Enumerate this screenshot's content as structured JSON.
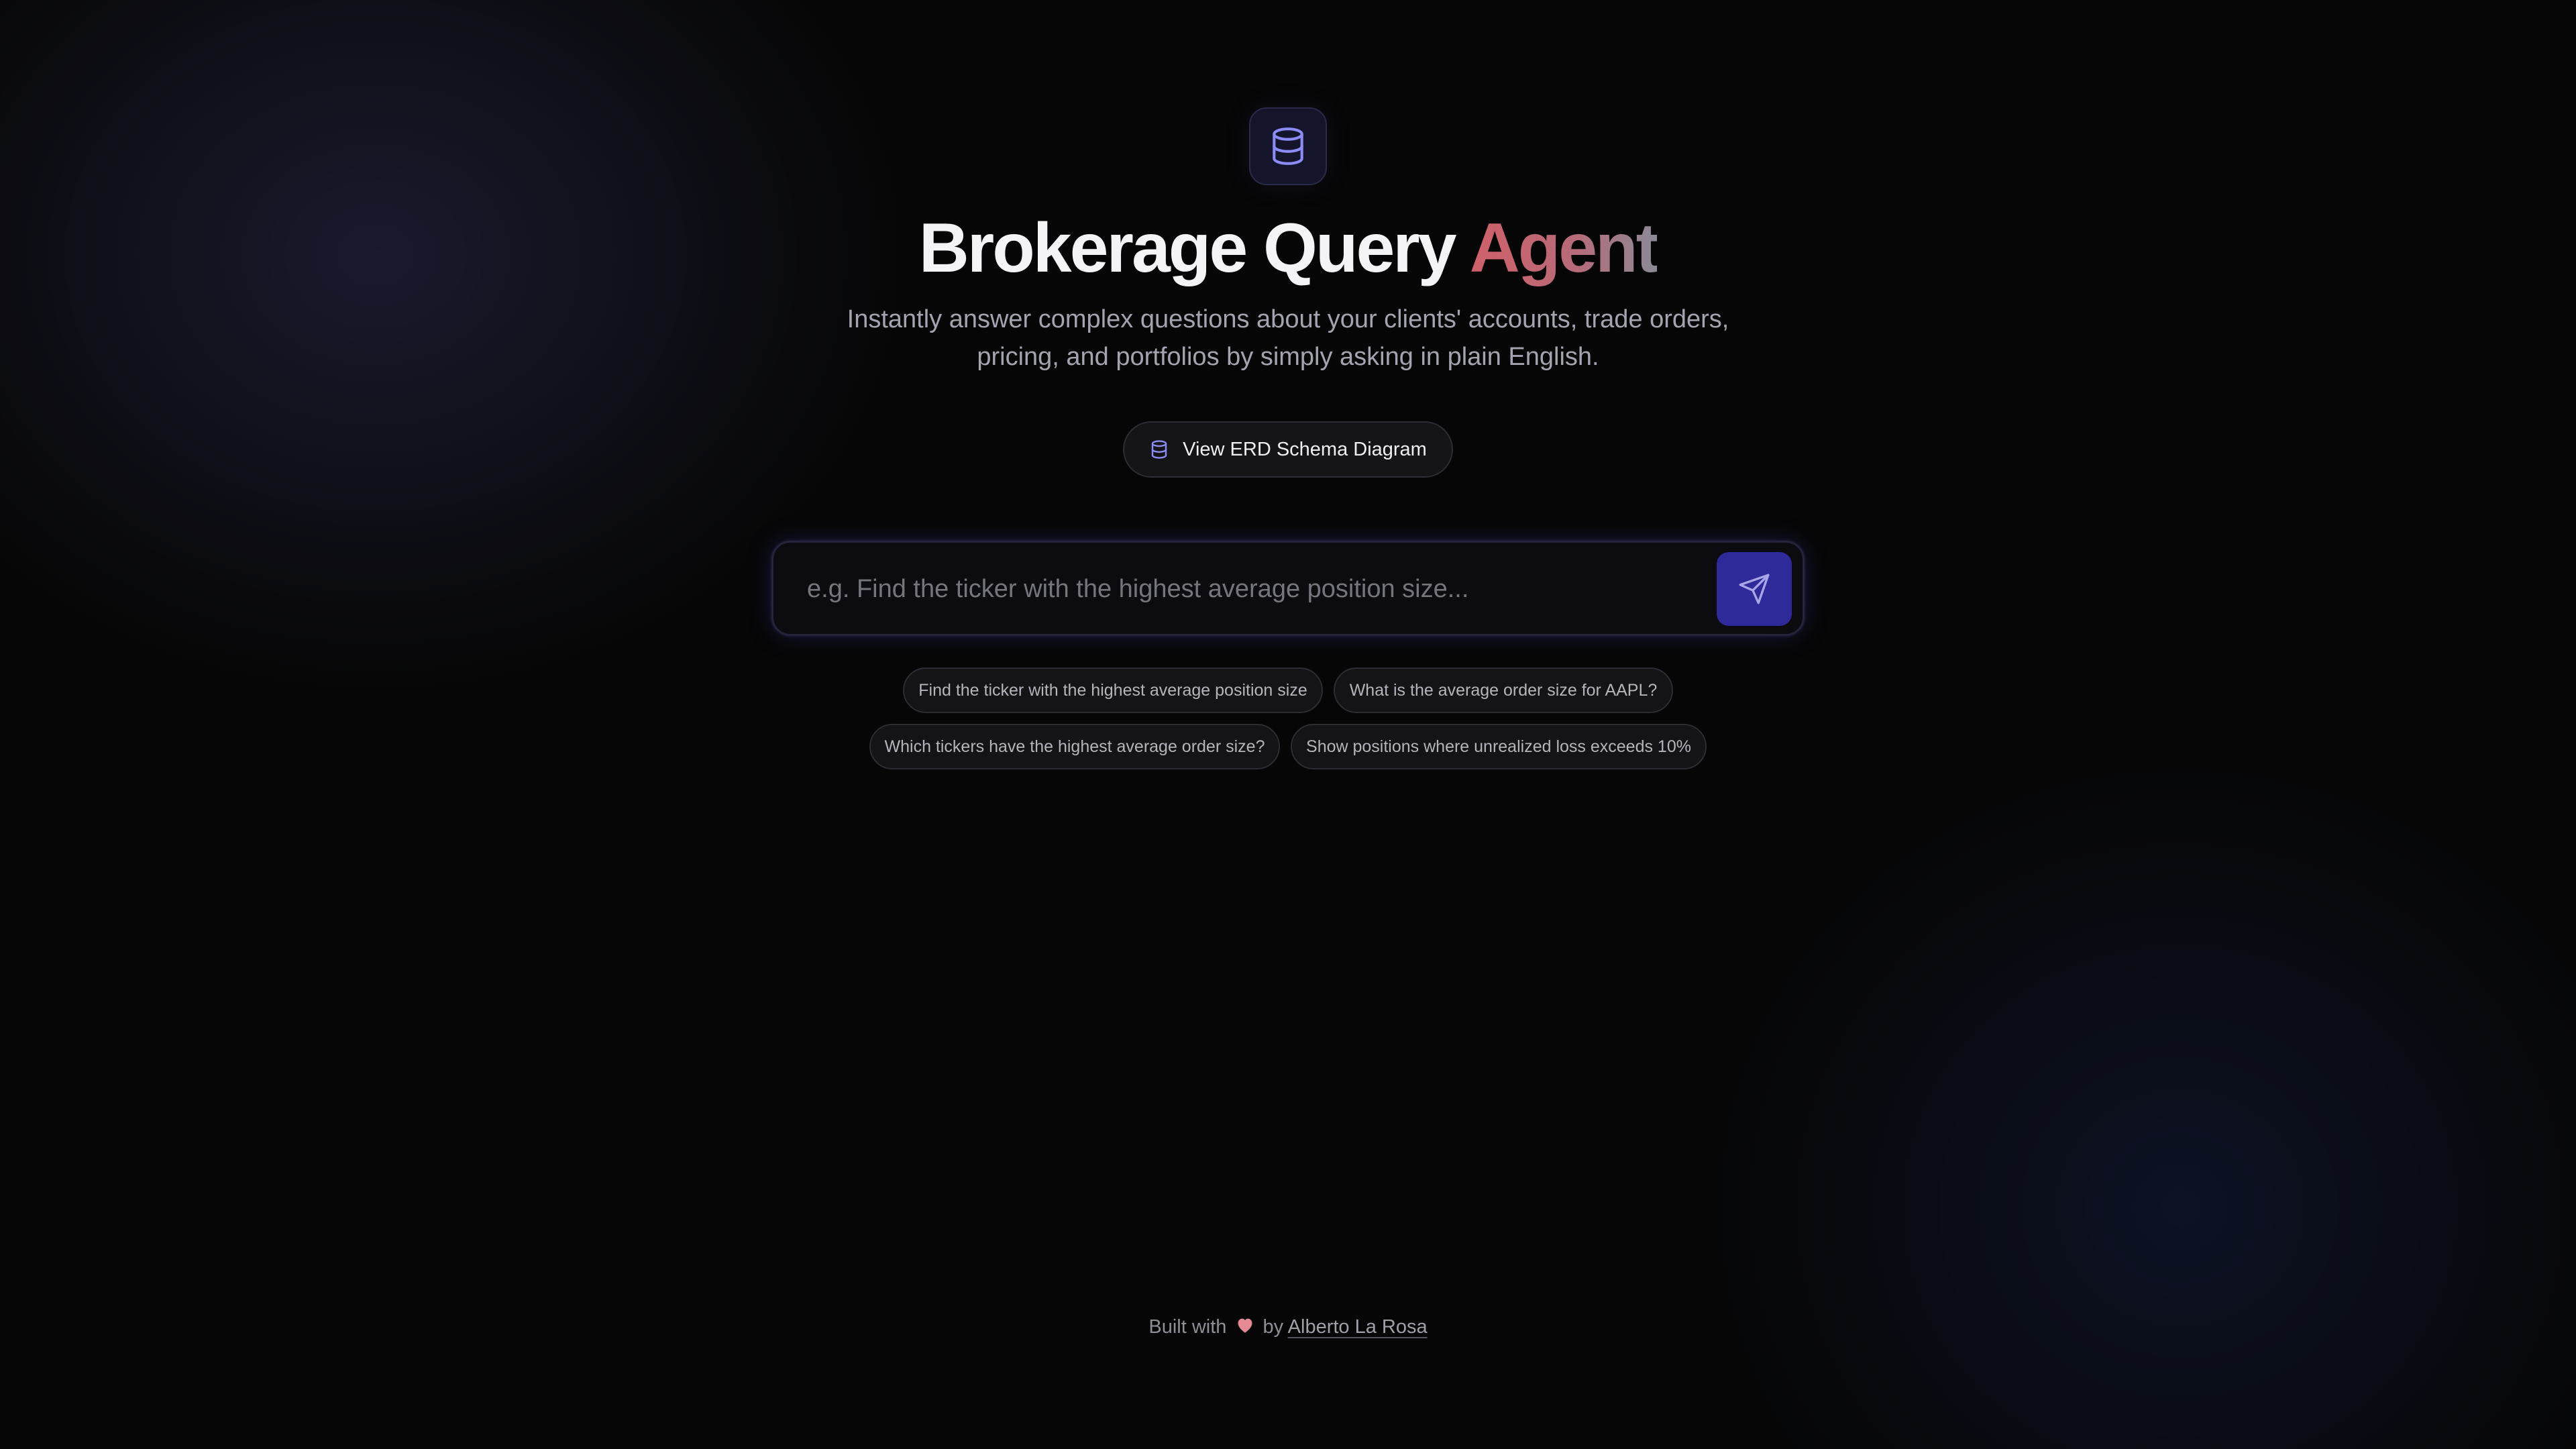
{
  "header": {
    "logo_icon": "database-icon",
    "title_main": "Brokerage Query ",
    "title_accent": "Agent",
    "subtitle": "Instantly answer complex questions about your clients' accounts, trade orders, pricing, and portfolios by simply asking in plain English."
  },
  "erd_button": {
    "icon": "database-icon",
    "label": "View ERD Schema Diagram"
  },
  "search": {
    "value": "",
    "placeholder": "e.g. Find the ticker with the highest average position size...",
    "send_icon": "send-icon"
  },
  "suggestions": [
    "Find the ticker with the highest average position size",
    "What is the average order size for AAPL?",
    "Which tickers have the highest average order size?",
    "Show positions where unrealized loss exceeds 10%"
  ],
  "footer": {
    "prefix": "Built with",
    "heart_icon": "heart-icon",
    "by": "by",
    "author": "Alberto La Rosa"
  },
  "colors": {
    "accent_start": "#d0606a",
    "accent_end": "#8a8a96",
    "send_button": "#2f2a9a",
    "icon_violet": "#8b8cf6",
    "heart": "#e58a92"
  }
}
